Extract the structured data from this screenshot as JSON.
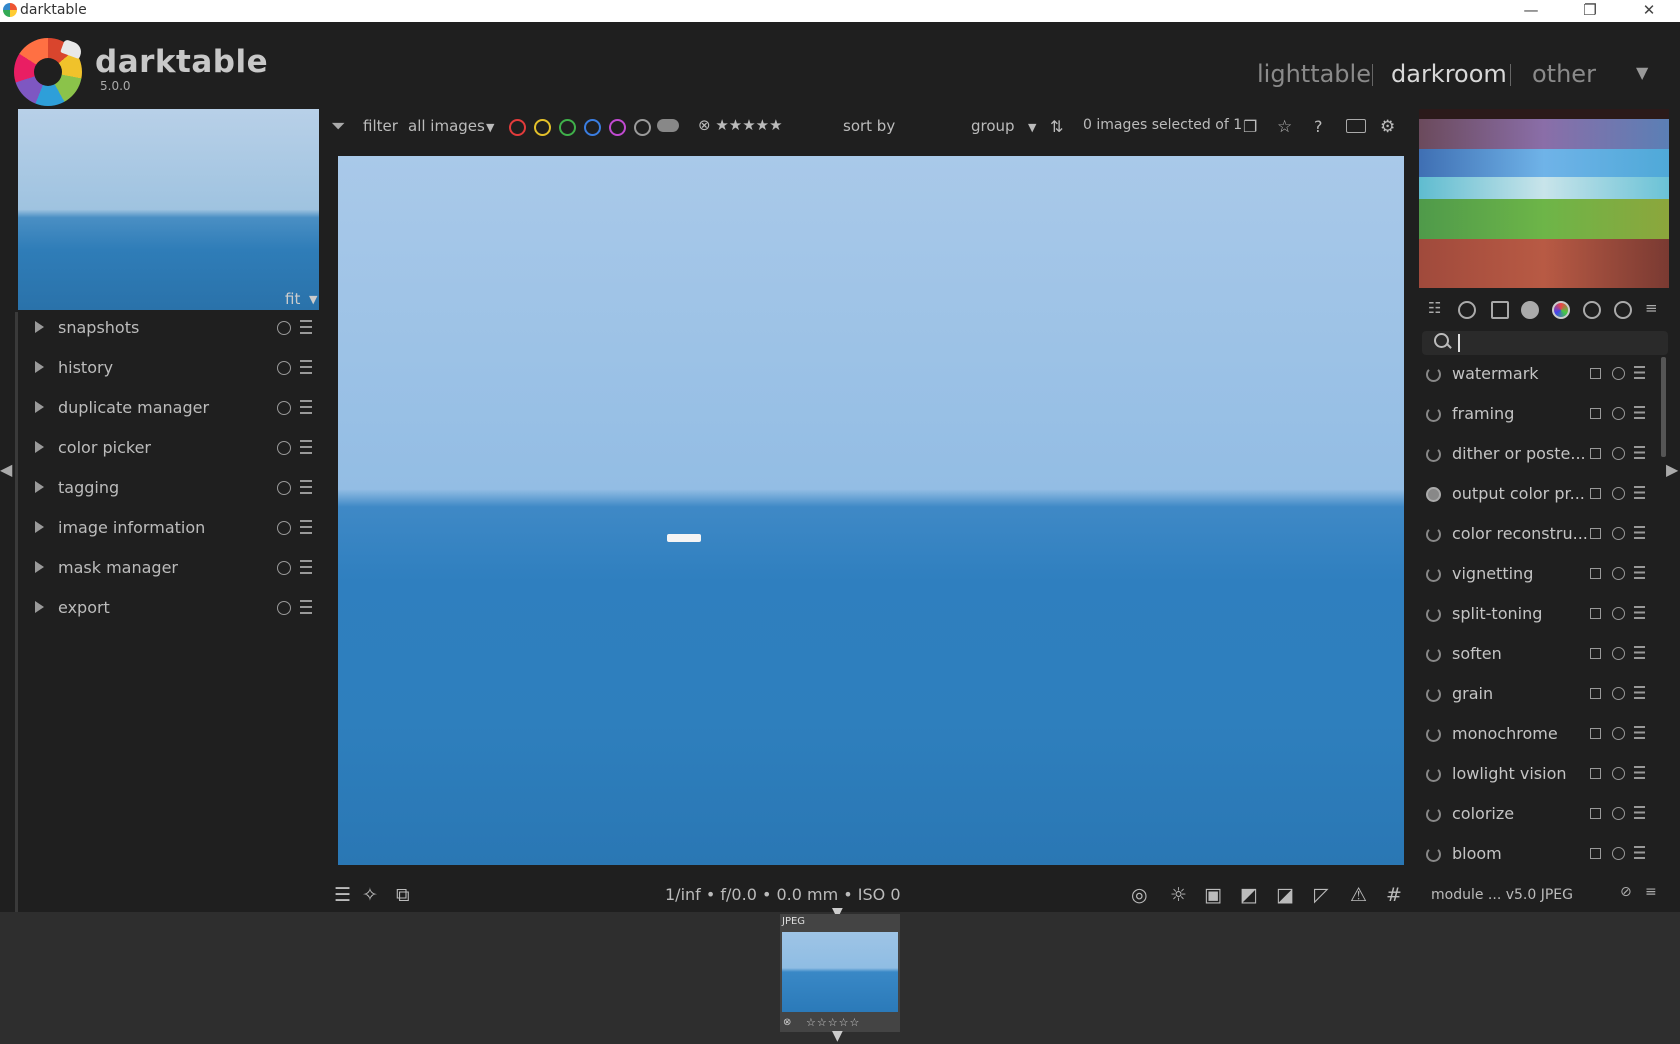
{
  "window": {
    "title": "darktable",
    "minimize": "—",
    "restore": "❐",
    "close": "✕"
  },
  "header": {
    "brand": "darktable",
    "version": "5.0.0",
    "views": {
      "lighttable": "lighttable",
      "darkroom": "darkroom",
      "other": "other"
    },
    "active_view": "darkroom"
  },
  "left_panel": {
    "zoom": "fit",
    "modules": [
      "snapshots",
      "history",
      "duplicate manager",
      "color picker",
      "tagging",
      "image information",
      "mask manager",
      "export"
    ]
  },
  "toolbar": {
    "filter_prefix": "filter",
    "filter_value": "all images",
    "sort_prefix": "sort by",
    "sort_value": "group",
    "selection_status": "0 images selected of 1",
    "color_labels": [
      "#e23b3b",
      "#e3c02a",
      "#3fb04a",
      "#3a7de0",
      "#c04ad0",
      "#9a9a9a"
    ],
    "rating_icons": "⊗ ★★★★★"
  },
  "right_panel": {
    "search_placeholder": "",
    "modules": [
      "watermark",
      "framing",
      "dither or poste...",
      "output color pr...",
      "color reconstru...",
      "vignetting",
      "split-toning",
      "soften",
      "grain",
      "monochrome",
      "lowlight vision",
      "colorize",
      "bloom"
    ]
  },
  "bottom": {
    "exif": "1/inf • f/0.0 • 0.0 mm • ISO 0",
    "module_info": "module ... v5.0 JPEG"
  },
  "filmstrip": {
    "format": "JPEG",
    "stars": "☆☆☆☆☆"
  }
}
